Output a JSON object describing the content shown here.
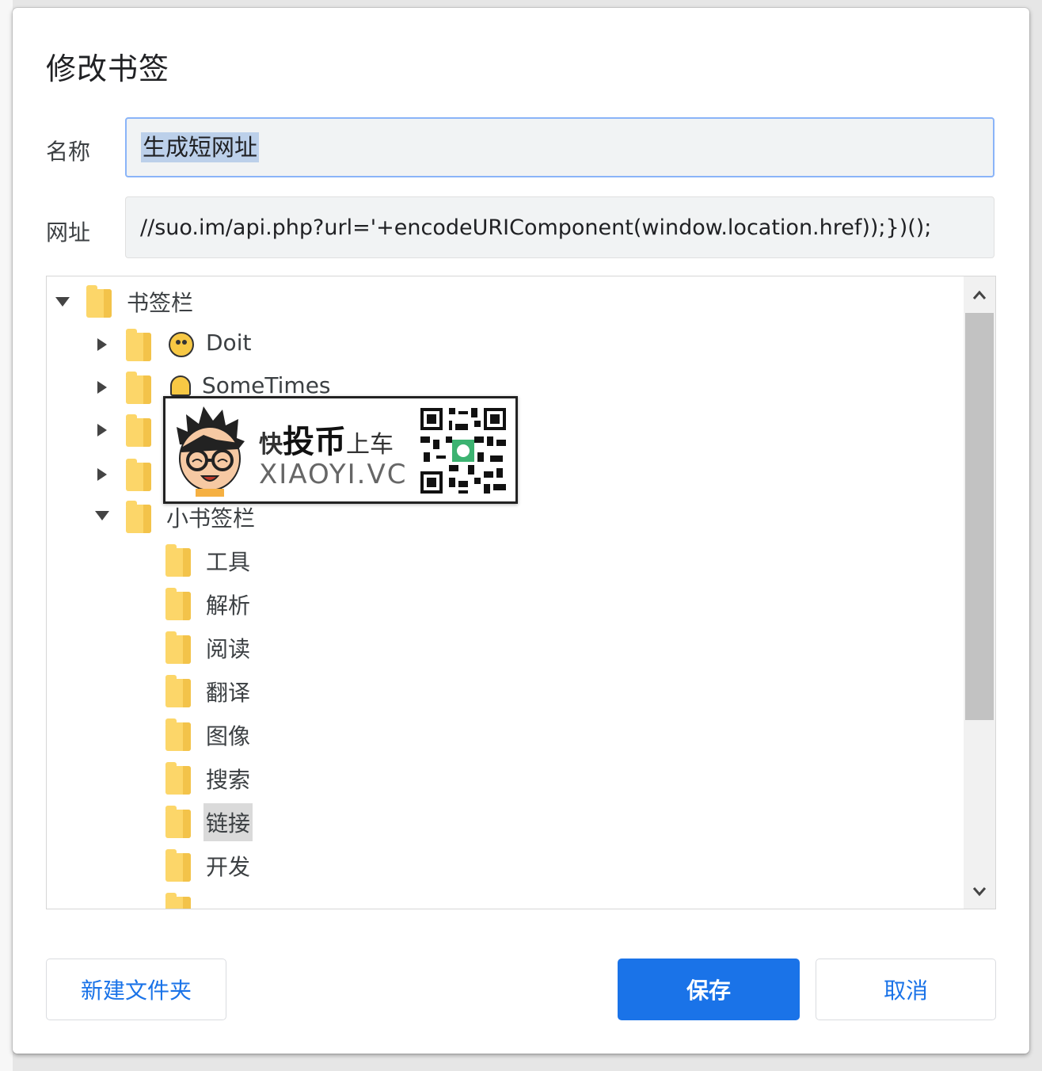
{
  "dialog": {
    "title": "修改书签",
    "name_label": "名称",
    "name_value": "生成短网址",
    "url_label": "网址",
    "url_value": "//suo.im/api.php?url='+encodeURIComponent(window.location.href));})();"
  },
  "tree": {
    "root": {
      "label": "书签栏",
      "expanded": true
    },
    "children": [
      {
        "label": "Doit",
        "icon": "smiley-emoji-icon",
        "expanded": false
      },
      {
        "label": "SomeTimes",
        "icon": "bell-emoji-icon",
        "expanded": false
      },
      {
        "label": "",
        "expanded": false
      },
      {
        "label": "",
        "expanded": false
      },
      {
        "label": "小书签栏",
        "expanded": true
      }
    ],
    "sub_items": [
      "工具",
      "解析",
      "阅读",
      "翻译",
      "图像",
      "搜索",
      "链接",
      "开发"
    ],
    "selected": "链接"
  },
  "watermark": {
    "tag_a": "快",
    "tag_b": "投币",
    "tag_c": "上车",
    "site": "XIAOYI.VC"
  },
  "buttons": {
    "new_folder": "新建文件夹",
    "save": "保存",
    "cancel": "取消"
  },
  "colors": {
    "accent": "#1a73e8",
    "input_focus_border": "#8ab4f8",
    "folder": "#fcd669",
    "selection": "#bcd0ea"
  }
}
